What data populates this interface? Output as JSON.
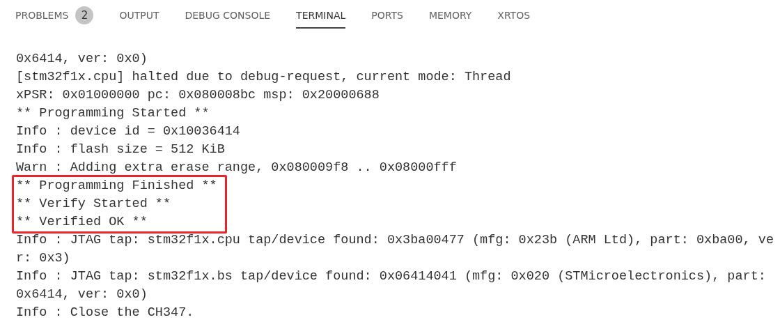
{
  "panel_tabs": [
    {
      "label": "PROBLEMS",
      "selected": false,
      "badge": "2"
    },
    {
      "label": "OUTPUT",
      "selected": false
    },
    {
      "label": "DEBUG CONSOLE",
      "selected": false
    },
    {
      "label": "TERMINAL",
      "selected": true
    },
    {
      "label": "PORTS",
      "selected": false
    },
    {
      "label": "MEMORY",
      "selected": false
    },
    {
      "label": "XRTOS",
      "selected": false
    }
  ],
  "terminal": {
    "lines": [
      {
        "text": "0x6414, ver: 0x0)",
        "boxed": false
      },
      {
        "text": "[stm32f1x.cpu] halted due to debug-request, current mode: Thread",
        "boxed": false
      },
      {
        "text": "xPSR: 0x01000000 pc: 0x080008bc msp: 0x20000688",
        "boxed": false
      },
      {
        "text": "** Programming Started **",
        "boxed": false
      },
      {
        "text": "Info : device id = 0x10036414",
        "boxed": false
      },
      {
        "text": "Info : flash size = 512 KiB",
        "boxed": false
      },
      {
        "text": "Warn : Adding extra erase range, 0x080009f8 .. 0x08000fff",
        "boxed": false
      },
      {
        "text": "** Programming Finished **",
        "boxed": true
      },
      {
        "text": "** Verify Started **",
        "boxed": true
      },
      {
        "text": "** Verified OK **",
        "boxed": true
      },
      {
        "text": "Info : JTAG tap: stm32f1x.cpu tap/device found: 0x3ba00477 (mfg: 0x23b (ARM Ltd), part: 0xba00, ve",
        "boxed": false
      },
      {
        "text": "r: 0x3)",
        "boxed": false
      },
      {
        "text": "Info : JTAG tap: stm32f1x.bs tap/device found: 0x06414041 (mfg: 0x020 (STMicroelectronics), part:",
        "boxed": false
      },
      {
        "text": "0x6414, ver: 0x0)",
        "boxed": false
      },
      {
        "text": "Info : Close the CH347.",
        "boxed": false
      }
    ]
  }
}
